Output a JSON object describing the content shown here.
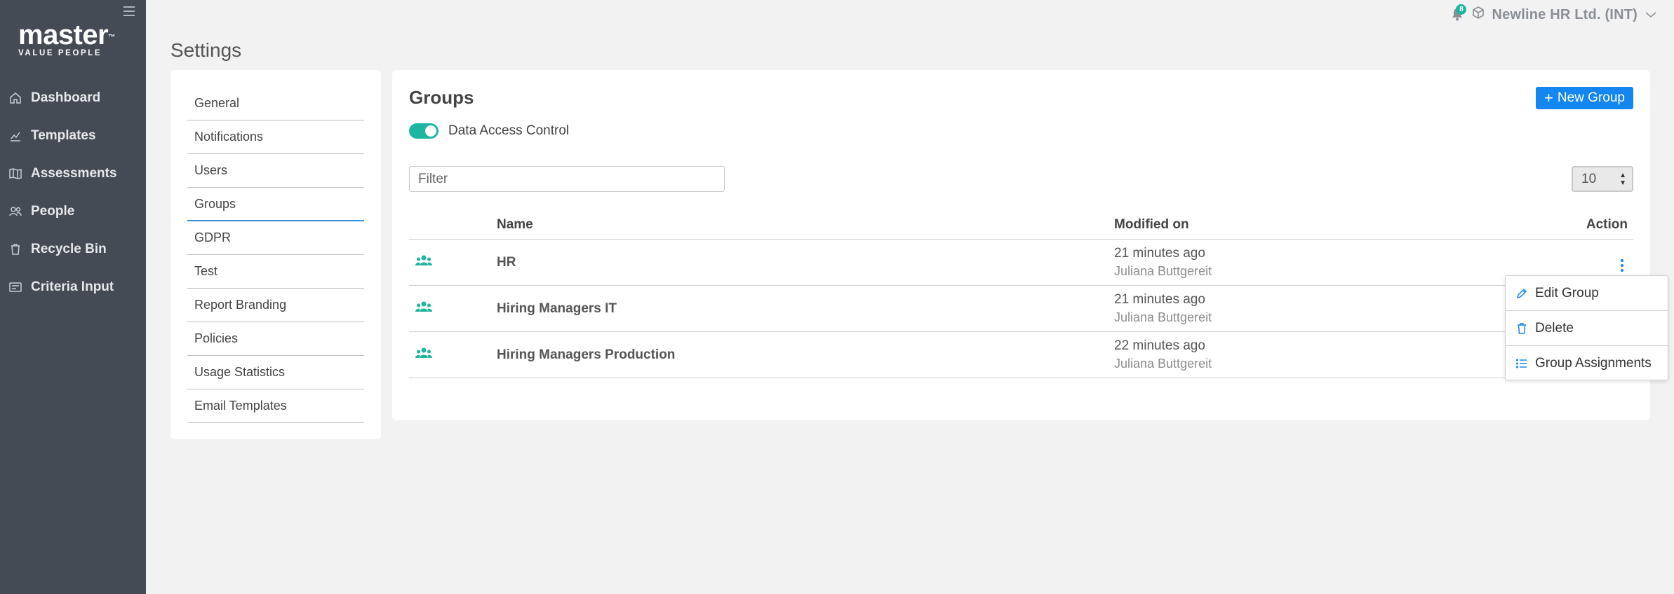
{
  "sidebar": {
    "logo_main": "master",
    "logo_tm": "™",
    "logo_sub": "VALUE PEOPLE",
    "items": [
      {
        "label": "Dashboard",
        "icon": "home-icon"
      },
      {
        "label": "Templates",
        "icon": "chart-icon"
      },
      {
        "label": "Assessments",
        "icon": "book-icon"
      },
      {
        "label": "People",
        "icon": "people-icon"
      },
      {
        "label": "Recycle Bin",
        "icon": "trash-icon"
      },
      {
        "label": "Criteria Input",
        "icon": "form-icon"
      }
    ]
  },
  "topbar": {
    "notification_count": "8",
    "company": "Newline HR Ltd. (INT)"
  },
  "page": {
    "title": "Settings"
  },
  "settings_nav": {
    "items": [
      "General",
      "Notifications",
      "Users",
      "Groups",
      "GDPR",
      "Test",
      "Report Branding",
      "Policies",
      "Usage Statistics",
      "Email Templates"
    ],
    "active": "Groups"
  },
  "groups": {
    "title": "Groups",
    "new_button": "New Group",
    "toggle_label": "Data Access Control",
    "toggle_on": true,
    "filter_placeholder": "Filter",
    "page_size": "10",
    "columns": {
      "name": "Name",
      "modified": "Modified on",
      "action": "Action"
    },
    "rows": [
      {
        "name": "HR",
        "modified": "21 minutes ago",
        "user": "Juliana Buttgereit"
      },
      {
        "name": "Hiring Managers IT",
        "modified": "21 minutes ago",
        "user": "Juliana Buttgereit"
      },
      {
        "name": "Hiring Managers Production",
        "modified": "22 minutes ago",
        "user": "Juliana Buttgereit"
      }
    ]
  },
  "action_menu": {
    "items": [
      {
        "label": "Edit Group",
        "icon": "pencil-icon"
      },
      {
        "label": "Delete",
        "icon": "trash-icon"
      },
      {
        "label": "Group Assignments",
        "icon": "list-icon"
      }
    ]
  },
  "colors": {
    "sidebar_bg": "#444b55",
    "accent_teal": "#1fb5a0",
    "primary_blue": "#1486f0"
  }
}
